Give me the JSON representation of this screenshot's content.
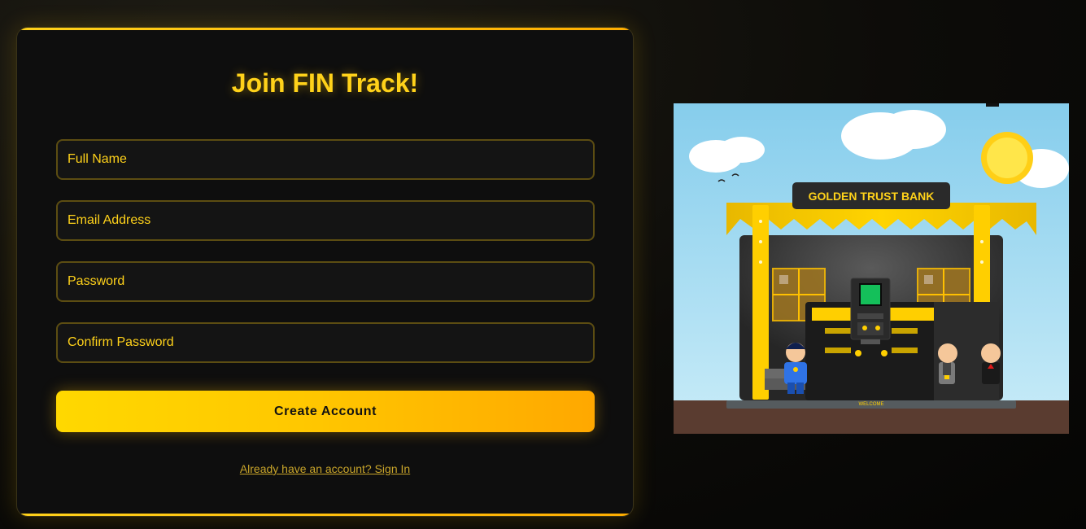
{
  "form": {
    "title": "Join FIN Track!",
    "fields": [
      {
        "placeholder": "Full Name",
        "value": ""
      },
      {
        "placeholder": "Email Address",
        "value": ""
      },
      {
        "placeholder": "Password",
        "value": ""
      },
      {
        "placeholder": "Confirm Password",
        "value": ""
      }
    ],
    "submit_label": "Create Account",
    "signin_link": "Already have an account? Sign In"
  },
  "illustration": {
    "bank_sign": "GOLDEN TRUST BANK",
    "welcome_mat": "WELCOME"
  },
  "colors": {
    "accent": "#ffd21a",
    "accent_end": "#ffa800",
    "card_bg": "#0e0e0e",
    "sky": "#8fd0ee",
    "ground": "#5a3c30"
  }
}
